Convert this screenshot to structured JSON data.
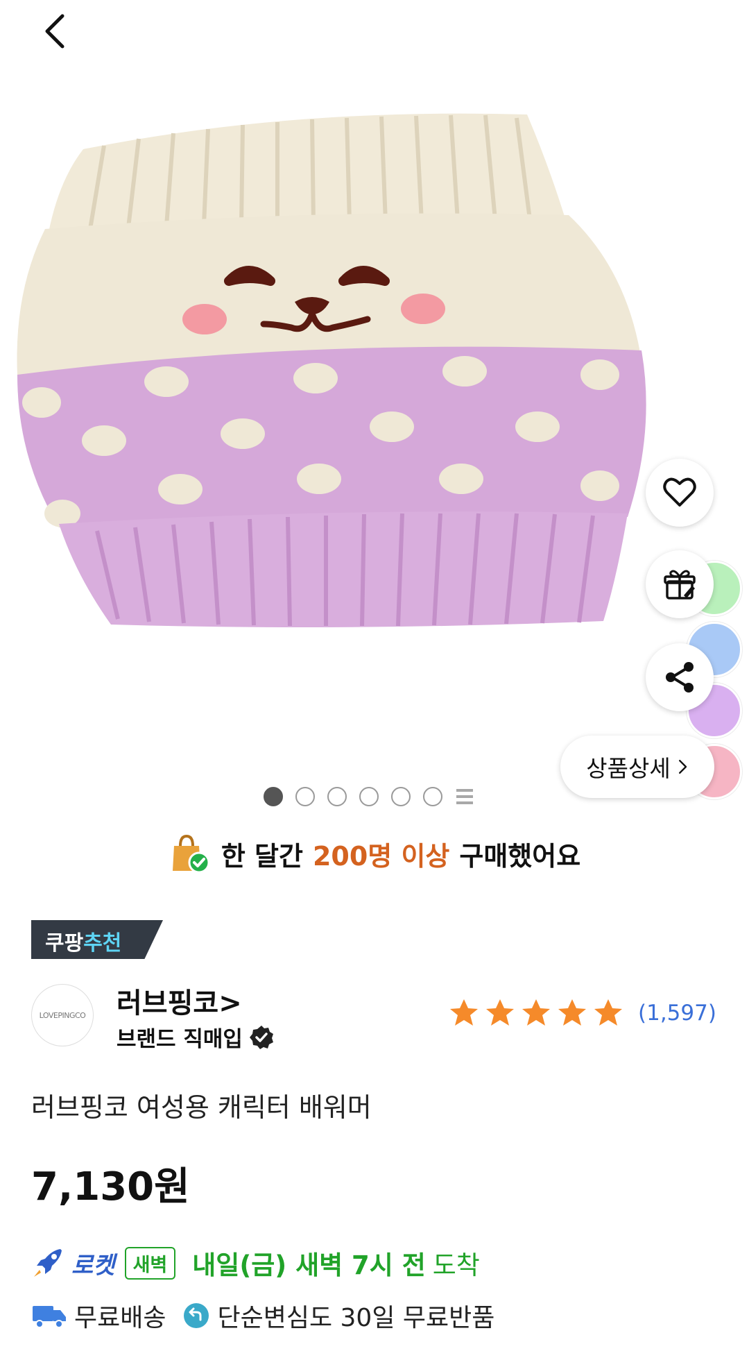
{
  "header": {
    "back_icon": "chevron-left-icon"
  },
  "gallery": {
    "dots_total": 6,
    "active_index": 0,
    "swatch_colors": [
      "#b9f0bb",
      "#a9c9f6",
      "#d9b0f0",
      "#f6b5c4"
    ],
    "detail_button_label": "상품상세",
    "action_icons": [
      "heart-icon",
      "gift-icon",
      "share-icon"
    ]
  },
  "purchase_info": {
    "prefix": "한 달간",
    "highlight": "200명 이상",
    "suffix": "구매했어요"
  },
  "recommendation_badge": {
    "prefix": "쿠팡",
    "accent": "추천"
  },
  "brand": {
    "logo_text": "LOVEPINGCO",
    "name": "러브핑코>",
    "direct_label": "브랜드 직매입"
  },
  "rating": {
    "stars": 5,
    "review_count": "(1,597)"
  },
  "product": {
    "title": "러브핑코 여성용 캐릭터 배워머",
    "price": "7,130원"
  },
  "delivery": {
    "rocket_label": "로켓",
    "dawn_badge": "새벽",
    "arrival_strong": "내일(금) 새벽 7시 전",
    "arrival_light": "도착"
  },
  "shipping": {
    "free_shipping": "무료배송",
    "return_policy": "단순변심도 30일 무료반품"
  },
  "colors": {
    "accent_orange": "#d4621f",
    "rocket_blue": "#2f5fc8",
    "dawn_green": "#21a329",
    "review_blue": "#3a6fd8",
    "star_orange": "#f58a2a"
  }
}
